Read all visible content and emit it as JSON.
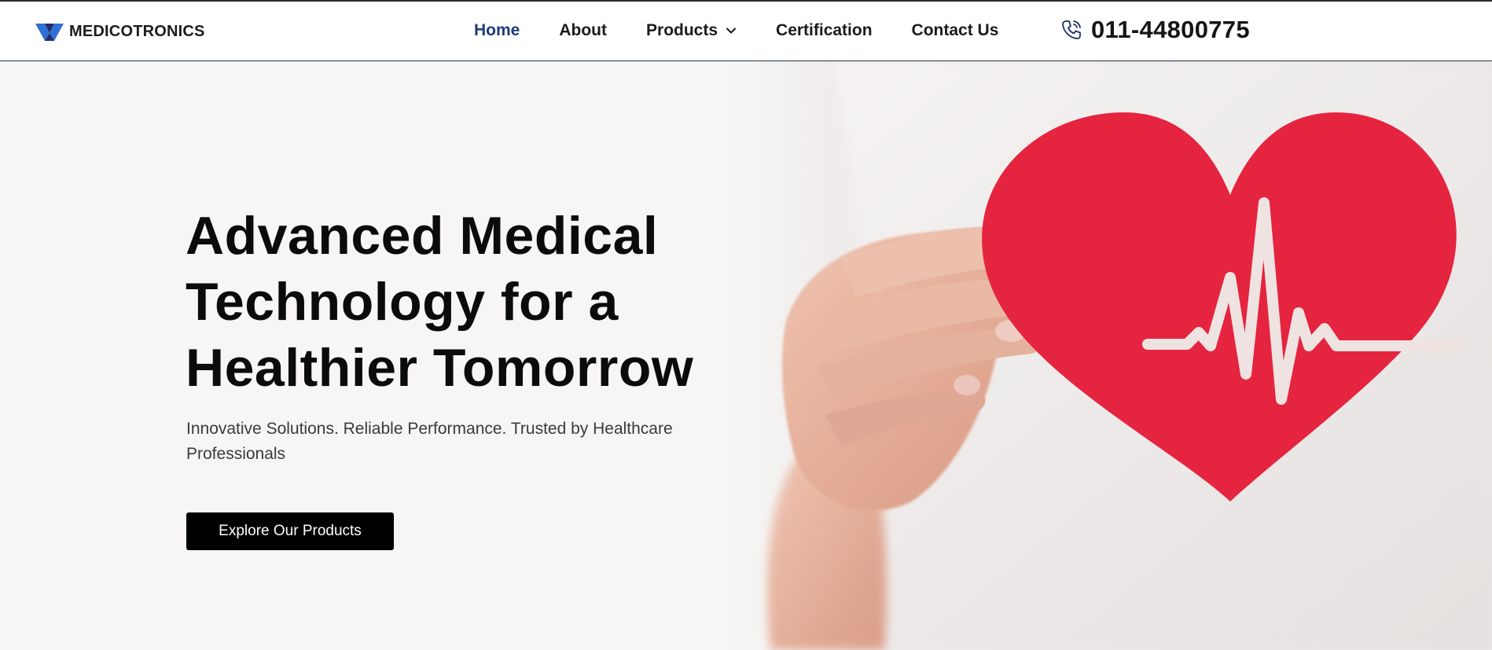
{
  "header": {
    "brand": "MEDICOTRONICS",
    "logo_icon": "medicotronics-logo",
    "nav": [
      {
        "label": "Home",
        "active": true
      },
      {
        "label": "About",
        "active": false
      },
      {
        "label": "Products",
        "active": false,
        "has_dropdown": true
      },
      {
        "label": "Certification",
        "active": false
      },
      {
        "label": "Contact Us",
        "active": false
      }
    ],
    "phone_icon": "phone-icon",
    "phone": "011-44800775"
  },
  "hero": {
    "title_lines": [
      "Advanced Medical",
      "Technology for a",
      "Healthier Tomorrow"
    ],
    "subtitle": "Innovative Solutions. Reliable Performance. Trusted by Healthcare Professionals",
    "cta_label": "Explore Our Products",
    "image": "hand-holding-red-paper-heart-with-heartbeat-line"
  },
  "colors": {
    "nav_active": "#1d3a7a",
    "nav_text": "#1b1b1b",
    "logo_blue": "#2f6fd6",
    "logo_navy": "#1b2e6b",
    "cta_bg": "#000000",
    "cta_text": "#ffffff",
    "heart_red": "#e5243f",
    "hero_bg": "#f7f6f4"
  }
}
